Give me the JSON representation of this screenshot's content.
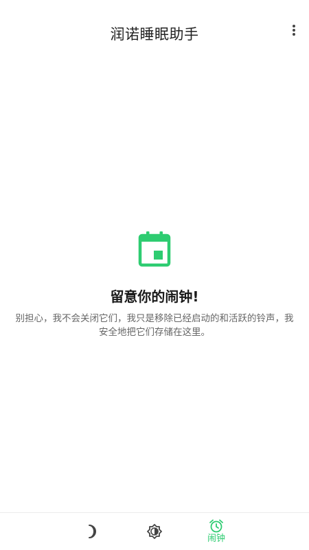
{
  "app_bar": {
    "title": "润诺睡眠助手",
    "menu_icon": "more-vert-icon"
  },
  "empty_state": {
    "icon": "calendar-icon",
    "title": "留意你的闹钟!",
    "description": "别担心，我不会关闭它们，我只是移除已经启动的和活跃的铃声，我安全地把它们存储在这里。"
  },
  "bottom_nav": {
    "items": [
      {
        "icon": "moon-icon",
        "label": ""
      },
      {
        "icon": "brightness-icon",
        "label": ""
      },
      {
        "icon": "alarm-clock-icon",
        "label": "闹钟",
        "active": true
      }
    ]
  },
  "colors": {
    "accent": "#2ecc71",
    "title_text": "#222222",
    "body_text": "#666666",
    "icon_gray": "#444444"
  }
}
